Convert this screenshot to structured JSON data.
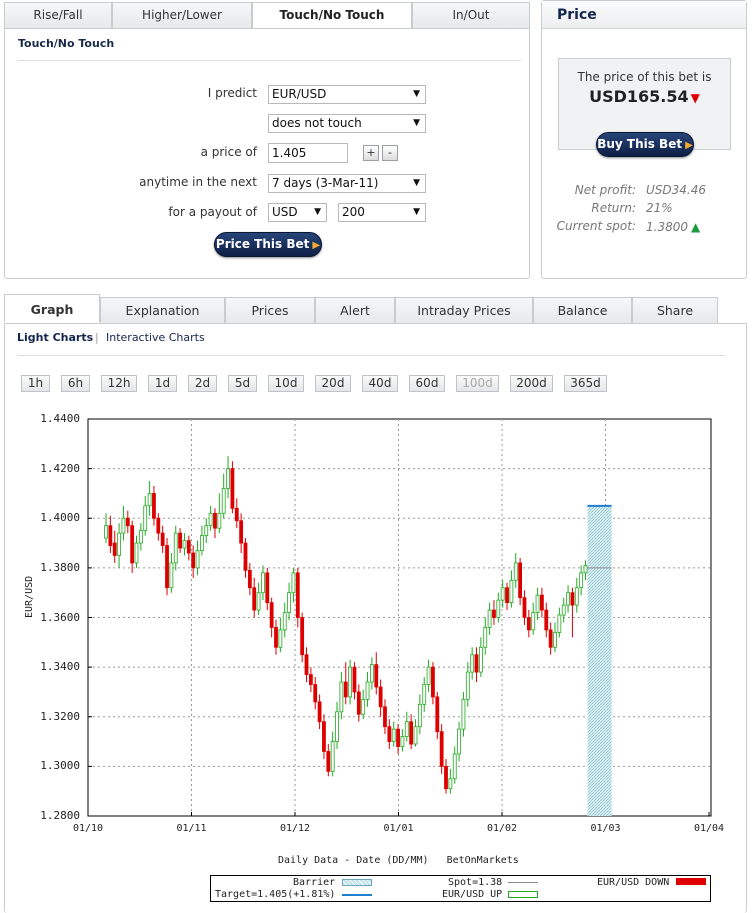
{
  "top_tabs": [
    {
      "label": "Rise/Fall"
    },
    {
      "label": "Higher/Lower"
    },
    {
      "label": "Touch/No Touch"
    },
    {
      "label": "In/Out"
    }
  ],
  "form": {
    "title": "Touch/No Touch",
    "predict_label": "I predict",
    "underlying": "EUR/USD",
    "outcome": "does not touch",
    "price_label": "a price of",
    "price_value": "1.405",
    "plus": "+",
    "minus": "-",
    "duration_label": "anytime in the next",
    "duration": "7 days (3-Mar-11)",
    "payout_label": "for a payout of",
    "currency": "USD",
    "payout": "200",
    "price_button": "Price This Bet"
  },
  "price_panel": {
    "title": "Price",
    "price_text": "The price of this bet is",
    "price_value": "USD165.54",
    "buy_button": "Buy This Bet",
    "net_profit_label": "Net profit:",
    "net_profit": "USD34.46",
    "return_label": "Return:",
    "return_value": "21%",
    "spot_label": "Current spot:",
    "spot_value": "1.3800"
  },
  "bottom_tabs": [
    {
      "label": "Graph"
    },
    {
      "label": "Explanation"
    },
    {
      "label": "Prices"
    },
    {
      "label": "Alert"
    },
    {
      "label": "Intraday Prices"
    },
    {
      "label": "Balance"
    },
    {
      "label": "Share"
    }
  ],
  "chart_links": {
    "light": "Light Charts",
    "separator": "|",
    "interactive": "Interactive Charts"
  },
  "ranges": [
    "1h",
    "6h",
    "12h",
    "1d",
    "2d",
    "5d",
    "10d",
    "20d",
    "40d",
    "60d",
    "100d",
    "200d",
    "365d"
  ],
  "legend": {
    "barrier": "Barrier",
    "target": "Target=1.405(+1.81%)",
    "spot": "Spot=1.38",
    "up": "EUR/USD UP",
    "down": "EUR/USD DOWN"
  },
  "colors": {
    "up": "#22aa22",
    "down": "#dd0000",
    "target": "#1e7fd0",
    "barrier": "#9fd0d8",
    "nav": "#13264d"
  },
  "chart_data": {
    "type": "candlestick",
    "xlabel": "Daily Data - Date (DD/MM)   BetOnMarkets",
    "ylabel": "EUR/USD",
    "ylim": [
      1.28,
      1.44
    ],
    "y_ticks": [
      "1.4400",
      "1.4200",
      "1.4000",
      "1.3800",
      "1.3600",
      "1.3400",
      "1.3200",
      "1.3000",
      "1.2800"
    ],
    "x_ticks": [
      "01/10",
      "01/11",
      "01/12",
      "01/01",
      "01/02",
      "01/03",
      "01/04"
    ],
    "grid": true,
    "barrier": 1.405,
    "spot": 1.38,
    "series": [
      {
        "open": 1.392,
        "close": 1.397,
        "high": 1.402,
        "low": 1.39
      },
      {
        "open": 1.397,
        "close": 1.389,
        "high": 1.401,
        "low": 1.386
      },
      {
        "open": 1.39,
        "close": 1.385,
        "high": 1.395,
        "low": 1.382
      },
      {
        "open": 1.385,
        "close": 1.394,
        "high": 1.398,
        "low": 1.38
      },
      {
        "open": 1.394,
        "close": 1.4,
        "high": 1.405,
        "low": 1.391
      },
      {
        "open": 1.4,
        "close": 1.397,
        "high": 1.403,
        "low": 1.394
      },
      {
        "open": 1.397,
        "close": 1.382,
        "high": 1.399,
        "low": 1.378
      },
      {
        "open": 1.382,
        "close": 1.39,
        "high": 1.393,
        "low": 1.38
      },
      {
        "open": 1.39,
        "close": 1.395,
        "high": 1.398,
        "low": 1.387
      },
      {
        "open": 1.395,
        "close": 1.405,
        "high": 1.409,
        "low": 1.393
      },
      {
        "open": 1.405,
        "close": 1.41,
        "high": 1.415,
        "low": 1.401
      },
      {
        "open": 1.41,
        "close": 1.4,
        "high": 1.413,
        "low": 1.397
      },
      {
        "open": 1.4,
        "close": 1.394,
        "high": 1.402,
        "low": 1.391
      },
      {
        "open": 1.394,
        "close": 1.389,
        "high": 1.397,
        "low": 1.386
      },
      {
        "open": 1.389,
        "close": 1.372,
        "high": 1.392,
        "low": 1.369
      },
      {
        "open": 1.372,
        "close": 1.382,
        "high": 1.386,
        "low": 1.37
      },
      {
        "open": 1.382,
        "close": 1.394,
        "high": 1.397,
        "low": 1.379
      },
      {
        "open": 1.394,
        "close": 1.388,
        "high": 1.396,
        "low": 1.386
      },
      {
        "open": 1.388,
        "close": 1.391,
        "high": 1.394,
        "low": 1.385
      },
      {
        "open": 1.391,
        "close": 1.386,
        "high": 1.393,
        "low": 1.383
      },
      {
        "open": 1.386,
        "close": 1.38,
        "high": 1.389,
        "low": 1.376
      },
      {
        "open": 1.38,
        "close": 1.387,
        "high": 1.391,
        "low": 1.377
      },
      {
        "open": 1.387,
        "close": 1.393,
        "high": 1.397,
        "low": 1.385
      },
      {
        "open": 1.393,
        "close": 1.397,
        "high": 1.4,
        "low": 1.39
      },
      {
        "open": 1.397,
        "close": 1.402,
        "high": 1.405,
        "low": 1.395
      },
      {
        "open": 1.402,
        "close": 1.396,
        "high": 1.404,
        "low": 1.392
      },
      {
        "open": 1.396,
        "close": 1.402,
        "high": 1.41,
        "low": 1.394
      },
      {
        "open": 1.402,
        "close": 1.412,
        "high": 1.418,
        "low": 1.4
      },
      {
        "open": 1.412,
        "close": 1.42,
        "high": 1.425,
        "low": 1.408
      },
      {
        "open": 1.42,
        "close": 1.404,
        "high": 1.423,
        "low": 1.402
      },
      {
        "open": 1.404,
        "close": 1.399,
        "high": 1.408,
        "low": 1.396
      },
      {
        "open": 1.399,
        "close": 1.39,
        "high": 1.402,
        "low": 1.386
      },
      {
        "open": 1.39,
        "close": 1.379,
        "high": 1.392,
        "low": 1.376
      },
      {
        "open": 1.379,
        "close": 1.372,
        "high": 1.382,
        "low": 1.369
      },
      {
        "open": 1.372,
        "close": 1.363,
        "high": 1.376,
        "low": 1.36
      },
      {
        "open": 1.363,
        "close": 1.37,
        "high": 1.374,
        "low": 1.361
      },
      {
        "open": 1.37,
        "close": 1.378,
        "high": 1.381,
        "low": 1.367
      },
      {
        "open": 1.378,
        "close": 1.366,
        "high": 1.38,
        "low": 1.363
      },
      {
        "open": 1.366,
        "close": 1.356,
        "high": 1.368,
        "low": 1.352
      },
      {
        "open": 1.356,
        "close": 1.348,
        "high": 1.359,
        "low": 1.345
      },
      {
        "open": 1.348,
        "close": 1.355,
        "high": 1.36,
        "low": 1.346
      },
      {
        "open": 1.355,
        "close": 1.362,
        "high": 1.366,
        "low": 1.352
      },
      {
        "open": 1.362,
        "close": 1.37,
        "high": 1.374,
        "low": 1.359
      },
      {
        "open": 1.37,
        "close": 1.378,
        "high": 1.38,
        "low": 1.366
      },
      {
        "open": 1.378,
        "close": 1.36,
        "high": 1.38,
        "low": 1.356
      },
      {
        "open": 1.36,
        "close": 1.345,
        "high": 1.362,
        "low": 1.342
      },
      {
        "open": 1.345,
        "close": 1.337,
        "high": 1.348,
        "low": 1.334
      },
      {
        "open": 1.337,
        "close": 1.333,
        "high": 1.34,
        "low": 1.33
      },
      {
        "open": 1.333,
        "close": 1.326,
        "high": 1.336,
        "low": 1.323
      },
      {
        "open": 1.326,
        "close": 1.318,
        "high": 1.329,
        "low": 1.315
      },
      {
        "open": 1.318,
        "close": 1.306,
        "high": 1.321,
        "low": 1.303
      },
      {
        "open": 1.306,
        "close": 1.298,
        "high": 1.309,
        "low": 1.296
      },
      {
        "open": 1.298,
        "close": 1.31,
        "high": 1.314,
        "low": 1.296
      },
      {
        "open": 1.31,
        "close": 1.322,
        "high": 1.326,
        "low": 1.307
      },
      {
        "open": 1.322,
        "close": 1.334,
        "high": 1.338,
        "low": 1.319
      },
      {
        "open": 1.334,
        "close": 1.328,
        "high": 1.342,
        "low": 1.325
      },
      {
        "open": 1.328,
        "close": 1.34,
        "high": 1.343,
        "low": 1.325
      },
      {
        "open": 1.34,
        "close": 1.33,
        "high": 1.342,
        "low": 1.327
      },
      {
        "open": 1.33,
        "close": 1.321,
        "high": 1.333,
        "low": 1.318
      },
      {
        "open": 1.321,
        "close": 1.327,
        "high": 1.331,
        "low": 1.319
      },
      {
        "open": 1.327,
        "close": 1.334,
        "high": 1.338,
        "low": 1.324
      },
      {
        "open": 1.334,
        "close": 1.341,
        "high": 1.344,
        "low": 1.331
      },
      {
        "open": 1.341,
        "close": 1.332,
        "high": 1.346,
        "low": 1.329
      },
      {
        "open": 1.332,
        "close": 1.324,
        "high": 1.335,
        "low": 1.32
      },
      {
        "open": 1.324,
        "close": 1.316,
        "high": 1.327,
        "low": 1.313
      },
      {
        "open": 1.316,
        "close": 1.31,
        "high": 1.319,
        "low": 1.307
      },
      {
        "open": 1.31,
        "close": 1.315,
        "high": 1.318,
        "low": 1.308
      },
      {
        "open": 1.315,
        "close": 1.308,
        "high": 1.317,
        "low": 1.305
      },
      {
        "open": 1.308,
        "close": 1.312,
        "high": 1.315,
        "low": 1.306
      },
      {
        "open": 1.312,
        "close": 1.318,
        "high": 1.322,
        "low": 1.31
      },
      {
        "open": 1.318,
        "close": 1.309,
        "high": 1.321,
        "low": 1.307
      },
      {
        "open": 1.309,
        "close": 1.316,
        "high": 1.319,
        "low": 1.308
      },
      {
        "open": 1.316,
        "close": 1.325,
        "high": 1.329,
        "low": 1.313
      },
      {
        "open": 1.325,
        "close": 1.333,
        "high": 1.336,
        "low": 1.322
      },
      {
        "open": 1.333,
        "close": 1.34,
        "high": 1.343,
        "low": 1.33
      },
      {
        "open": 1.34,
        "close": 1.328,
        "high": 1.342,
        "low": 1.325
      },
      {
        "open": 1.328,
        "close": 1.314,
        "high": 1.33,
        "low": 1.311
      },
      {
        "open": 1.314,
        "close": 1.3,
        "high": 1.317,
        "low": 1.297
      },
      {
        "open": 1.3,
        "close": 1.291,
        "high": 1.303,
        "low": 1.289
      },
      {
        "open": 1.291,
        "close": 1.295,
        "high": 1.299,
        "low": 1.289
      },
      {
        "open": 1.295,
        "close": 1.305,
        "high": 1.308,
        "low": 1.293
      },
      {
        "open": 1.305,
        "close": 1.315,
        "high": 1.318,
        "low": 1.302
      },
      {
        "open": 1.315,
        "close": 1.327,
        "high": 1.33,
        "low": 1.312
      },
      {
        "open": 1.327,
        "close": 1.338,
        "high": 1.342,
        "low": 1.324
      },
      {
        "open": 1.338,
        "close": 1.345,
        "high": 1.348,
        "low": 1.335
      },
      {
        "open": 1.345,
        "close": 1.338,
        "high": 1.348,
        "low": 1.334
      },
      {
        "open": 1.338,
        "close": 1.348,
        "high": 1.352,
        "low": 1.336
      },
      {
        "open": 1.348,
        "close": 1.356,
        "high": 1.36,
        "low": 1.345
      },
      {
        "open": 1.356,
        "close": 1.363,
        "high": 1.366,
        "low": 1.353
      },
      {
        "open": 1.363,
        "close": 1.36,
        "high": 1.367,
        "low": 1.357
      },
      {
        "open": 1.36,
        "close": 1.367,
        "high": 1.37,
        "low": 1.358
      },
      {
        "open": 1.367,
        "close": 1.372,
        "high": 1.375,
        "low": 1.364
      },
      {
        "open": 1.372,
        "close": 1.366,
        "high": 1.374,
        "low": 1.363
      },
      {
        "open": 1.366,
        "close": 1.375,
        "high": 1.379,
        "low": 1.364
      },
      {
        "open": 1.375,
        "close": 1.382,
        "high": 1.386,
        "low": 1.372
      },
      {
        "open": 1.382,
        "close": 1.368,
        "high": 1.384,
        "low": 1.365
      },
      {
        "open": 1.368,
        "close": 1.36,
        "high": 1.371,
        "low": 1.357
      },
      {
        "open": 1.36,
        "close": 1.355,
        "high": 1.363,
        "low": 1.352
      },
      {
        "open": 1.355,
        "close": 1.362,
        "high": 1.366,
        "low": 1.353
      },
      {
        "open": 1.362,
        "close": 1.369,
        "high": 1.372,
        "low": 1.359
      },
      {
        "open": 1.369,
        "close": 1.363,
        "high": 1.372,
        "low": 1.36
      },
      {
        "open": 1.363,
        "close": 1.355,
        "high": 1.366,
        "low": 1.352
      },
      {
        "open": 1.355,
        "close": 1.348,
        "high": 1.358,
        "low": 1.345
      },
      {
        "open": 1.348,
        "close": 1.354,
        "high": 1.358,
        "low": 1.346
      },
      {
        "open": 1.354,
        "close": 1.361,
        "high": 1.364,
        "low": 1.352
      },
      {
        "open": 1.361,
        "close": 1.365,
        "high": 1.368,
        "low": 1.358
      },
      {
        "open": 1.365,
        "close": 1.37,
        "high": 1.373,
        "low": 1.362
      },
      {
        "open": 1.37,
        "close": 1.365,
        "high": 1.372,
        "low": 1.352
      },
      {
        "open": 1.365,
        "close": 1.372,
        "high": 1.376,
        "low": 1.362
      },
      {
        "open": 1.372,
        "close": 1.378,
        "high": 1.381,
        "low": 1.369
      },
      {
        "open": 1.378,
        "close": 1.381,
        "high": 1.383,
        "low": 1.375
      }
    ]
  }
}
